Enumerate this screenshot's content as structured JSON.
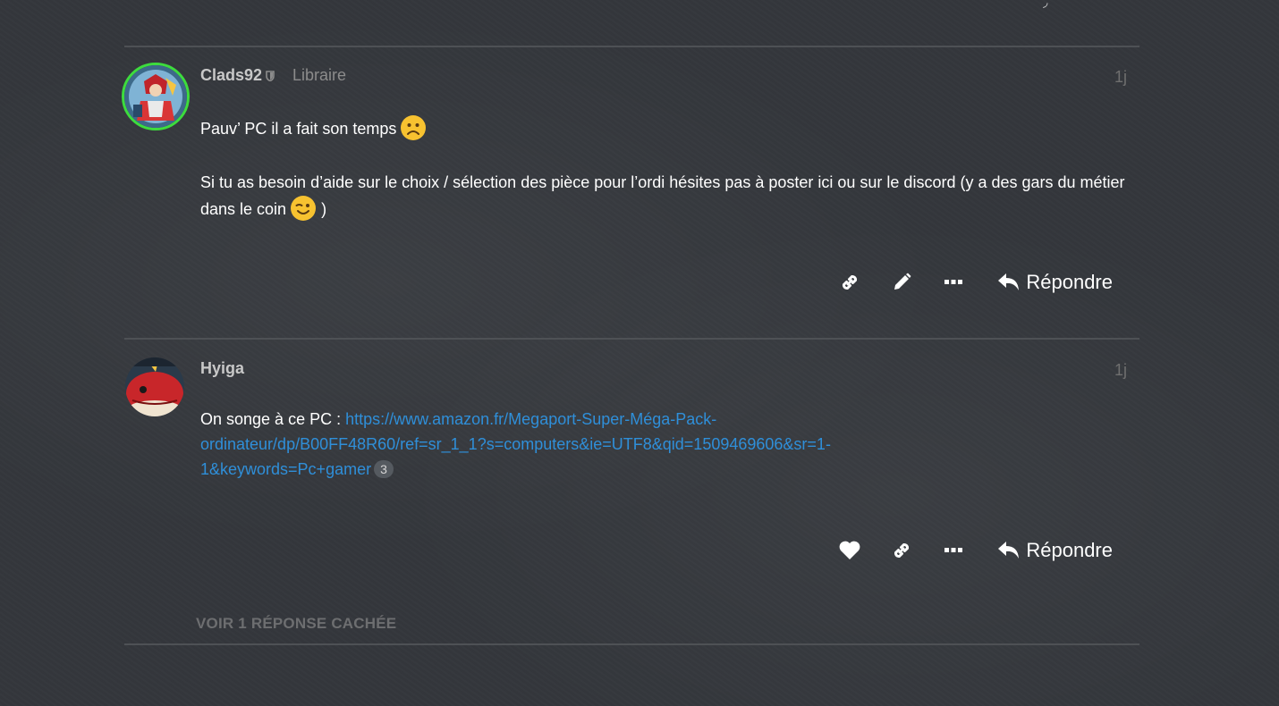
{
  "posts": [
    {
      "username": "Clads92",
      "user_title": "Libraire",
      "date": "1j",
      "paragraphs": [
        "Pauv’ PC il a fait son temps",
        "Si tu as besoin d’aide sur le choix / sélection des pièce pour l’ordi hésites pas à poster ici ou sur le discord (y a des gars du métier dans le coin",
        ")"
      ],
      "emoji": [
        "frowning-face-icon",
        "winking-face-icon"
      ],
      "actions": {
        "icons": [
          "link-icon",
          "pencil-icon",
          "more-icon"
        ],
        "reply_label": "Répondre"
      }
    },
    {
      "username": "Hyiga",
      "date": "1j",
      "text_prefix": "On songe à ce PC :",
      "link_text": "https://www.amazon.fr/Megaport-Super-Méga-Pack-ordinateur/dp/B00FF48R60/ref=sr_1_1?s=computers&ie=UTF8&qid=1509469606&sr=1-1&keywords=Pc+gamer",
      "link_clicks": "3",
      "actions": {
        "icons": [
          "heart-icon",
          "link-icon",
          "more-icon"
        ],
        "reply_label": "Répondre"
      }
    }
  ],
  "hidden_replies_label": "VOIR 1 RÉPONSE CACHÉE",
  "colors": {
    "background": "#34373c",
    "link": "#2f8fd9",
    "divider": "#4e5155",
    "avatar_ring": "#3ddc3d"
  }
}
